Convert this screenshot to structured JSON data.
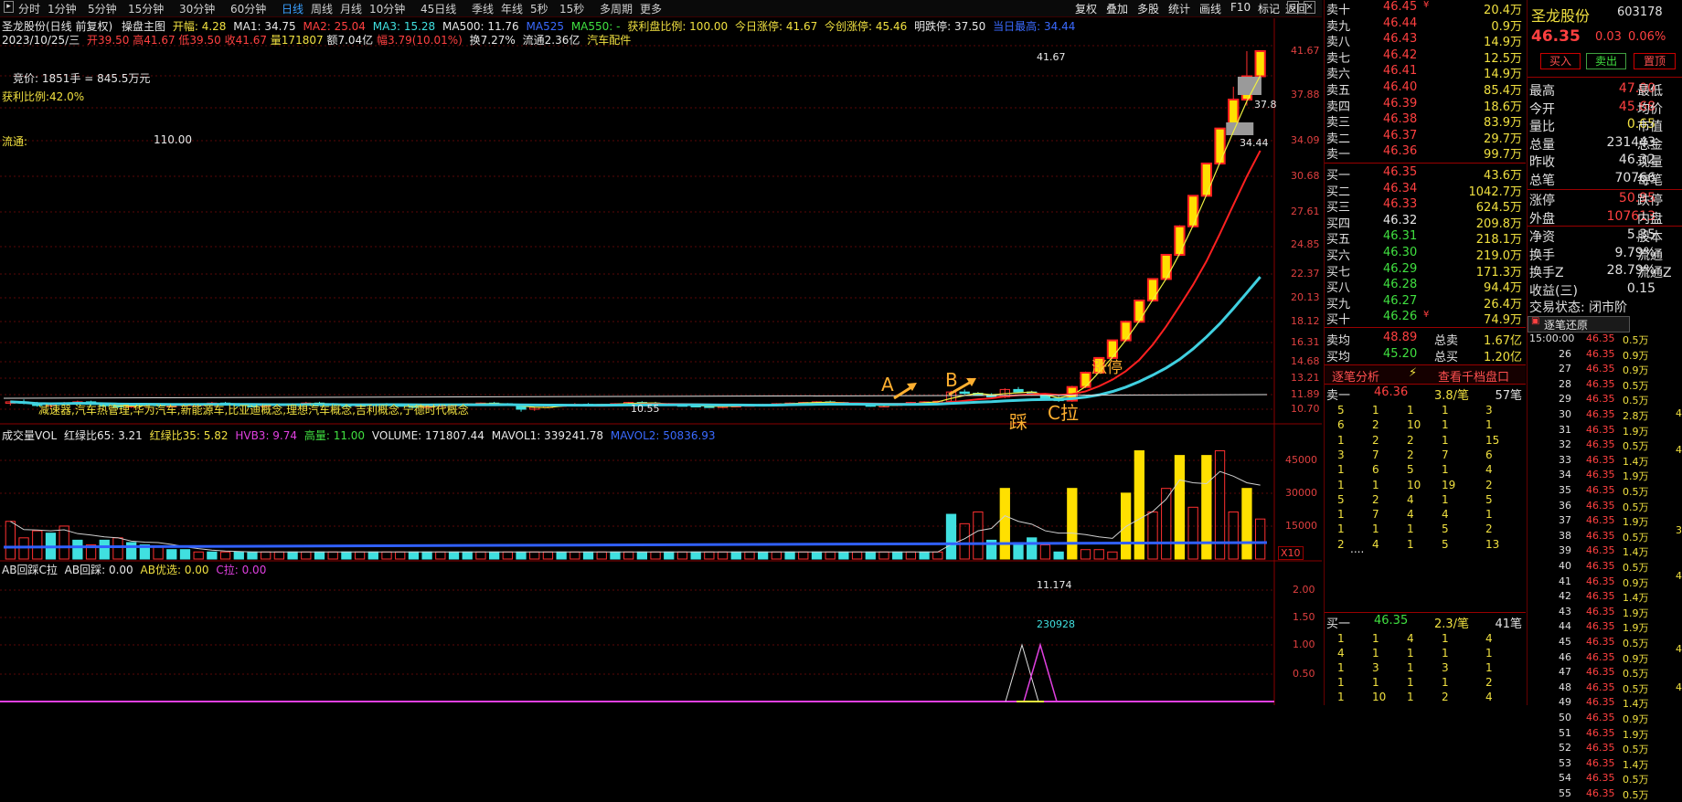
{
  "toolbar": {
    "periods": [
      "分时",
      "1分钟",
      "5分钟",
      "15分钟",
      "30分钟",
      "60分钟",
      "日线",
      "周线",
      "月线",
      "10分钟",
      "45日线",
      "季线",
      "年线",
      "5秒",
      "15秒",
      "多周期",
      "更多"
    ],
    "active_index": 6,
    "right": [
      "复权",
      "叠加",
      "多股",
      "统计",
      "画线",
      "F10",
      "标记",
      "返回"
    ]
  },
  "header": {
    "stock": "圣龙股份(日线 前复权)",
    "indicator": "操盘主图",
    "open_range_label": "开幅: 4.28",
    "ma1": "MA1: 34.75",
    "ma2": "MA2: 25.04",
    "ma3": "MA3: 15.28",
    "ma500": "MA500: 11.76",
    "ma525": "MA525",
    "ma550": "MA550: -",
    "profit_ratio": "获利盘比例: 100.00",
    "limit_up": "今日涨停: 41.67",
    "new_high": "今创涨停: 45.46",
    "limit_down": "明跌停: 37.50",
    "hist_high": "当日最高: 34.44"
  },
  "header2": {
    "date": "2023/10/25/三",
    "open": "开39.50",
    "high": "高41.67",
    "low": "低39.50",
    "close": "收41.67",
    "vol": "量171807",
    "amount": "额7.04亿",
    "change": "幅3.79(10.01%)",
    "turnover": "换7.27%",
    "float": "流通2.36亿",
    "sector": "汽车配件"
  },
  "main_overlay": {
    "bid_price": "竞价: 1851手 = 845.5万元",
    "profit_pct": "获利比例:42.0%",
    "liutong_label": "流通:",
    "liutong_value": "110.00",
    "concepts": "减速器,汽车热管理,华为汽车,新能源车,比亚迪概念,理想汽车概念,吉利概念,宁德时代概念",
    "label_a": "A",
    "label_b": "B",
    "label_c": "C拉",
    "label_cai": "踩",
    "label_zhang": "涨停",
    "low_price": "10.55",
    "top_price": "41.67",
    "mid_price": "37.8",
    "price_34": "34.44"
  },
  "main_axis": [
    "41.67",
    "37.88",
    "34.09",
    "30.68",
    "27.61",
    "24.85",
    "22.37",
    "20.13",
    "18.12",
    "16.31",
    "14.68",
    "13.21",
    "11.89",
    "10.70"
  ],
  "vol_header": {
    "name": "成交量VOL",
    "hl65": "红绿比65: 3.21",
    "hl35": "红绿比35: 5.82",
    "hvb3": "HVB3: 9.74",
    "high": "高量: 11.00",
    "volume": "VOLUME: 171807.44",
    "mavol1": "MAVOL1: 339241.78",
    "mavol2": "MAVOL2: 50836.93"
  },
  "vol_axis": [
    "45000",
    "30000",
    "15000"
  ],
  "vol_unit": "X10",
  "ab_header": {
    "name": "AB回踩C拉",
    "ab_back": "AB回踩: 0.00",
    "ab_pick": "AB优选: 0.00",
    "c_pull": "C拉: 0.00"
  },
  "ab_labels": {
    "peak": "11.174",
    "date": "230928"
  },
  "ab_axis": [
    "2.00",
    "1.50",
    "1.00",
    "0.50"
  ],
  "orderbook": {
    "sells": [
      {
        "label": "卖十",
        "price": "46.45",
        "vol": "20.4万",
        "mark": "¥"
      },
      {
        "label": "卖九",
        "price": "46.44",
        "vol": "0.9万"
      },
      {
        "label": "卖八",
        "price": "46.43",
        "vol": "14.9万"
      },
      {
        "label": "卖七",
        "price": "46.42",
        "vol": "12.5万"
      },
      {
        "label": "卖六",
        "price": "46.41",
        "vol": "14.9万"
      },
      {
        "label": "卖五",
        "price": "46.40",
        "vol": "85.4万"
      },
      {
        "label": "卖四",
        "price": "46.39",
        "vol": "18.6万"
      },
      {
        "label": "卖三",
        "price": "46.38",
        "vol": "83.9万"
      },
      {
        "label": "卖二",
        "price": "46.37",
        "vol": "29.7万"
      },
      {
        "label": "卖一",
        "price": "46.36",
        "vol": "99.7万"
      }
    ],
    "buys": [
      {
        "label": "买一",
        "price": "46.35",
        "vol": "43.6万"
      },
      {
        "label": "买二",
        "price": "46.34",
        "vol": "1042.7万"
      },
      {
        "label": "买三",
        "price": "46.33",
        "vol": "624.5万"
      },
      {
        "label": "买四",
        "price": "46.32",
        "vol": "209.8万"
      },
      {
        "label": "买五",
        "price": "46.31",
        "vol": "218.1万"
      },
      {
        "label": "买六",
        "price": "46.30",
        "vol": "219.0万"
      },
      {
        "label": "买七",
        "price": "46.29",
        "vol": "171.3万"
      },
      {
        "label": "买八",
        "price": "46.28",
        "vol": "94.4万"
      },
      {
        "label": "买九",
        "price": "46.27",
        "vol": "26.4万"
      },
      {
        "label": "买十",
        "price": "46.26",
        "vol": "74.9万",
        "mark": "¥"
      }
    ],
    "avg_sell": {
      "label": "卖均",
      "price": "48.89",
      "tlabel": "总卖",
      "total": "1.67亿"
    },
    "avg_buy": {
      "label": "买均",
      "price": "45.20",
      "tlabel": "总买",
      "total": "1.20亿"
    },
    "tab1": "逐笔分析",
    "tab2": "查看千档盘口",
    "sell_one": {
      "label": "卖一",
      "price": "46.36",
      "per": "3.8/笔",
      "count": "57笔"
    },
    "buy_one": {
      "label": "买一",
      "price": "46.35",
      "per": "2.3/笔",
      "count": "41笔"
    },
    "sell_grid": [
      [
        "5",
        "1",
        "1",
        "1",
        "3"
      ],
      [
        "6",
        "2",
        "10",
        "1",
        "1"
      ],
      [
        "1",
        "2",
        "2",
        "1",
        "15"
      ],
      [
        "3",
        "7",
        "2",
        "7",
        "6"
      ],
      [
        "1",
        "6",
        "5",
        "1",
        "4"
      ],
      [
        "1",
        "1",
        "10",
        "19",
        "2"
      ],
      [
        "5",
        "2",
        "4",
        "1",
        "5"
      ],
      [
        "1",
        "7",
        "4",
        "4",
        "1"
      ],
      [
        "1",
        "1",
        "1",
        "5",
        "2"
      ],
      [
        "2",
        "4",
        "1",
        "5",
        "13"
      ]
    ],
    "ellipsis": "....",
    "buy_grid": [
      [
        "1",
        "1",
        "4",
        "1",
        "4"
      ],
      [
        "4",
        "1",
        "1",
        "1",
        "1"
      ],
      [
        "1",
        "3",
        "1",
        "3",
        "1"
      ],
      [
        "1",
        "1",
        "1",
        "1",
        "2"
      ],
      [
        "1",
        "10",
        "1",
        "2",
        "4"
      ]
    ]
  },
  "info": {
    "name": "圣龙股份",
    "code": "603178",
    "price": "46.35",
    "change": "0.03",
    "pct": "0.06%",
    "buy_btn": "买入",
    "sell_btn": "卖出",
    "trade_btn": "置顶",
    "rows": [
      {
        "k": "最高",
        "v": "47.00",
        "k2": "最低"
      },
      {
        "k": "今开",
        "v": "45.68",
        "k2": "均价"
      },
      {
        "k": "量比",
        "v": "0.65",
        "k2": "市值"
      },
      {
        "k": "总量",
        "v": "231443",
        "k2": "总金"
      },
      {
        "k": "昨收",
        "v": "46.32",
        "k2": "现量"
      },
      {
        "k": "总笔",
        "v": "70766",
        "k2": "每笔"
      }
    ],
    "rows2": [
      {
        "k": "涨停",
        "v": "50.95",
        "k2": "跌停"
      },
      {
        "k": "外盘",
        "v": "107613",
        "k2": "内盘"
      }
    ],
    "rows3": [
      {
        "k": "净资",
        "v": "5.35",
        "k2": "股本"
      },
      {
        "k": "换手",
        "v": "9.79%",
        "k2": "流通"
      },
      {
        "k": "换手Z",
        "v": "28.79%",
        "k2": "流通Z"
      },
      {
        "k": "收益(三)",
        "v": "0.15",
        "k2": ""
      }
    ],
    "status": "交易状态: 闭市阶",
    "ticks_title": "逐笔还原",
    "ticks": [
      {
        "t": "15:00:00",
        "p": "46.35",
        "v": "0.5万"
      },
      {
        "t": "26",
        "p": "46.35",
        "v": "0.9万"
      },
      {
        "t": "27",
        "p": "46.35",
        "v": "0.9万"
      },
      {
        "t": "28",
        "p": "46.35",
        "v": "0.5万"
      },
      {
        "t": "29",
        "p": "46.35",
        "v": "0.5万"
      },
      {
        "t": "30",
        "p": "46.35",
        "v": "2.8万"
      },
      {
        "t": "31",
        "p": "46.35",
        "v": "1.9万"
      },
      {
        "t": "32",
        "p": "46.35",
        "v": "0.5万"
      },
      {
        "t": "33",
        "p": "46.35",
        "v": "1.4万"
      },
      {
        "t": "34",
        "p": "46.35",
        "v": "1.9万"
      },
      {
        "t": "35",
        "p": "46.35",
        "v": "0.5万"
      },
      {
        "t": "36",
        "p": "46.35",
        "v": "0.5万"
      },
      {
        "t": "37",
        "p": "46.35",
        "v": "1.9万"
      },
      {
        "t": "38",
        "p": "46.35",
        "v": "0.5万"
      },
      {
        "t": "39",
        "p": "46.35",
        "v": "1.4万"
      },
      {
        "t": "40",
        "p": "46.35",
        "v": "0.5万"
      },
      {
        "t": "41",
        "p": "46.35",
        "v": "0.9万"
      },
      {
        "t": "42",
        "p": "46.35",
        "v": "1.4万"
      },
      {
        "t": "43",
        "p": "46.35",
        "v": "1.9万"
      },
      {
        "t": "44",
        "p": "46.35",
        "v": "1.9万"
      },
      {
        "t": "45",
        "p": "46.35",
        "v": "0.5万"
      },
      {
        "t": "46",
        "p": "46.35",
        "v": "0.9万"
      },
      {
        "t": "47",
        "p": "46.35",
        "v": "0.5万"
      },
      {
        "t": "48",
        "p": "46.35",
        "v": "0.5万"
      },
      {
        "t": "49",
        "p": "46.35",
        "v": "1.4万"
      },
      {
        "t": "50",
        "p": "46.35",
        "v": "0.9万"
      },
      {
        "t": "51",
        "p": "46.35",
        "v": "1.9万"
      },
      {
        "t": "52",
        "p": "46.35",
        "v": "0.5万"
      },
      {
        "t": "53",
        "p": "46.35",
        "v": "1.4万"
      },
      {
        "t": "54",
        "p": "46.35",
        "v": "0.5万"
      },
      {
        "t": "55",
        "p": "46.35",
        "v": "0.5万"
      }
    ],
    "side_nums": [
      "4",
      "4",
      "3",
      "4",
      "4",
      "4"
    ]
  },
  "candles": [
    [
      11.2,
      11.4,
      11.0,
      11.3
    ],
    [
      11.3,
      11.5,
      11.1,
      11.2
    ],
    [
      11.2,
      11.3,
      10.9,
      11.0
    ],
    [
      11.0,
      11.2,
      10.8,
      11.1
    ],
    [
      11.1,
      11.3,
      11.0,
      11.2
    ],
    [
      11.2,
      11.4,
      11.1,
      11.3
    ],
    [
      11.3,
      11.4,
      11.0,
      11.1
    ],
    [
      11.1,
      11.2,
      10.9,
      11.0
    ],
    [
      11.0,
      11.1,
      10.8,
      10.9
    ],
    [
      10.9,
      11.1,
      10.8,
      11.0
    ],
    [
      11.0,
      11.2,
      10.9,
      11.1
    ],
    [
      11.1,
      11.2,
      10.9,
      11.0
    ],
    [
      11.0,
      11.1,
      10.9,
      11.0
    ],
    [
      11.0,
      11.2,
      10.9,
      11.1
    ],
    [
      11.1,
      11.2,
      11.0,
      11.1
    ],
    [
      11.1,
      11.3,
      11.0,
      11.2
    ],
    [
      11.2,
      11.3,
      11.0,
      11.1
    ],
    [
      11.1,
      11.2,
      10.9,
      11.0
    ],
    [
      11.0,
      11.1,
      10.9,
      10.95
    ],
    [
      10.95,
      11.1,
      10.9,
      11.05
    ],
    [
      11.05,
      11.2,
      11.0,
      11.1
    ],
    [
      11.1,
      11.2,
      11.0,
      11.15
    ],
    [
      11.15,
      11.3,
      11.1,
      11.2
    ],
    [
      11.2,
      11.3,
      11.1,
      11.15
    ],
    [
      11.15,
      11.2,
      11.0,
      11.05
    ],
    [
      11.05,
      11.1,
      10.9,
      11.0
    ],
    [
      11.0,
      11.1,
      10.9,
      11.05
    ],
    [
      11.05,
      11.15,
      11.0,
      11.1
    ],
    [
      11.1,
      11.2,
      11.0,
      11.05
    ],
    [
      11.05,
      11.1,
      10.95,
      11.0
    ],
    [
      11.0,
      11.05,
      10.8,
      10.85
    ],
    [
      10.85,
      11.0,
      10.8,
      10.95
    ],
    [
      10.95,
      11.1,
      10.9,
      11.05
    ],
    [
      11.05,
      11.15,
      11.0,
      11.1
    ],
    [
      11.1,
      11.2,
      11.05,
      11.15
    ],
    [
      11.15,
      11.25,
      11.1,
      11.2
    ],
    [
      11.2,
      11.3,
      11.1,
      11.15
    ],
    [
      11.15,
      11.2,
      11.0,
      11.05
    ],
    [
      11.05,
      11.1,
      10.55,
      10.7
    ],
    [
      10.7,
      10.9,
      10.6,
      10.85
    ],
    [
      10.85,
      11.0,
      10.8,
      10.95
    ],
    [
      10.95,
      11.1,
      10.9,
      11.05
    ],
    [
      11.05,
      11.2,
      11.0,
      11.1
    ],
    [
      11.1,
      11.2,
      11.0,
      11.05
    ],
    [
      11.05,
      11.15,
      11.0,
      11.1
    ],
    [
      11.1,
      11.2,
      11.05,
      11.15
    ],
    [
      11.15,
      11.3,
      11.1,
      11.25
    ],
    [
      11.25,
      11.35,
      11.15,
      11.2
    ],
    [
      11.2,
      11.3,
      11.1,
      11.15
    ],
    [
      11.15,
      11.2,
      11.0,
      11.05
    ],
    [
      11.05,
      11.15,
      10.95,
      11.0
    ],
    [
      11.0,
      11.1,
      10.9,
      10.95
    ],
    [
      10.95,
      11.05,
      10.85,
      10.9
    ],
    [
      10.9,
      11.0,
      10.8,
      10.95
    ],
    [
      10.95,
      11.05,
      10.9,
      11.0
    ],
    [
      11.0,
      11.1,
      10.95,
      11.05
    ],
    [
      11.05,
      11.15,
      11.0,
      11.1
    ],
    [
      11.1,
      11.2,
      11.05,
      11.15
    ],
    [
      11.15,
      11.25,
      11.1,
      11.2
    ],
    [
      11.2,
      11.3,
      11.15,
      11.25
    ],
    [
      11.25,
      11.35,
      11.2,
      11.3
    ],
    [
      11.3,
      11.4,
      11.2,
      11.25
    ],
    [
      11.25,
      11.3,
      11.1,
      11.15
    ],
    [
      11.15,
      11.2,
      11.0,
      11.05
    ],
    [
      11.05,
      11.1,
      10.9,
      10.95
    ],
    [
      10.95,
      11.05,
      10.85,
      11.0
    ],
    [
      11.0,
      11.2,
      10.95,
      11.15
    ],
    [
      11.15,
      11.3,
      11.1,
      11.25
    ],
    [
      11.25,
      11.35,
      11.2,
      11.3
    ],
    [
      11.3,
      11.4,
      11.25,
      11.35
    ],
    [
      11.35,
      12.2,
      11.3,
      12.1
    ],
    [
      12.1,
      12.3,
      11.9,
      12.0
    ],
    [
      12.0,
      12.1,
      11.8,
      11.9
    ],
    [
      11.9,
      12.0,
      11.6,
      11.7
    ],
    [
      11.7,
      12.4,
      11.6,
      12.3
    ],
    [
      12.3,
      12.5,
      12.0,
      12.1
    ],
    [
      12.1,
      12.2,
      11.8,
      11.9
    ],
    [
      11.9,
      12.0,
      11.5,
      11.6
    ],
    [
      11.6,
      11.8,
      11.3,
      11.4
    ],
    [
      11.4,
      12.6,
      11.3,
      12.5
    ],
    [
      12.5,
      13.8,
      12.4,
      13.7
    ],
    [
      13.7,
      15.0,
      13.6,
      15.0
    ],
    [
      15.0,
      16.5,
      14.9,
      16.5
    ],
    [
      16.5,
      18.2,
      16.4,
      18.1
    ],
    [
      18.1,
      19.9,
      18.0,
      19.9
    ],
    [
      19.9,
      21.9,
      19.8,
      21.9
    ],
    [
      21.9,
      24.0,
      21.8,
      24.0
    ],
    [
      24.0,
      26.5,
      23.9,
      26.4
    ],
    [
      26.4,
      29.0,
      26.3,
      29.0
    ],
    [
      29.0,
      31.9,
      28.9,
      31.9
    ],
    [
      31.9,
      35.1,
      31.8,
      35.1
    ],
    [
      35.1,
      38.6,
      34.9,
      37.5
    ],
    [
      37.5,
      41.67,
      37.0,
      39.5
    ],
    [
      39.5,
      41.67,
      39.5,
      41.67
    ]
  ],
  "volumes": [
    [
      16,
      1
    ],
    [
      9,
      1
    ],
    [
      12,
      1
    ],
    [
      11,
      0
    ],
    [
      14,
      1
    ],
    [
      8,
      0
    ],
    [
      6,
      1
    ],
    [
      8,
      0
    ],
    [
      9,
      1
    ],
    [
      7,
      0
    ],
    [
      6,
      0
    ],
    [
      5,
      1
    ],
    [
      4,
      0
    ],
    [
      4,
      0
    ],
    [
      3,
      1
    ],
    [
      3,
      0
    ],
    [
      3,
      1
    ],
    [
      3,
      0
    ],
    [
      3,
      0
    ],
    [
      3,
      1
    ],
    [
      3,
      1
    ],
    [
      3,
      0
    ],
    [
      3,
      1
    ],
    [
      3,
      0
    ],
    [
      3,
      1
    ],
    [
      3,
      0
    ],
    [
      3,
      1
    ],
    [
      3,
      0
    ],
    [
      3,
      1
    ],
    [
      3,
      1
    ],
    [
      3,
      0
    ],
    [
      3,
      0
    ],
    [
      3,
      1
    ],
    [
      3,
      0
    ],
    [
      3,
      0
    ],
    [
      3,
      1
    ],
    [
      3,
      0
    ],
    [
      3,
      1
    ],
    [
      3,
      0
    ],
    [
      3,
      1
    ],
    [
      3,
      1
    ],
    [
      3,
      0
    ],
    [
      3,
      1
    ],
    [
      3,
      0
    ],
    [
      3,
      1
    ],
    [
      3,
      0
    ],
    [
      3,
      1
    ],
    [
      3,
      0
    ],
    [
      3,
      1
    ],
    [
      3,
      0
    ],
    [
      3,
      1
    ],
    [
      3,
      0
    ],
    [
      3,
      1
    ],
    [
      3,
      1
    ],
    [
      3,
      0
    ],
    [
      3,
      1
    ],
    [
      3,
      0
    ],
    [
      3,
      1
    ],
    [
      3,
      0
    ],
    [
      3,
      1
    ],
    [
      3,
      0
    ],
    [
      3,
      1
    ],
    [
      3,
      0
    ],
    [
      3,
      1
    ],
    [
      3,
      0
    ],
    [
      3,
      1
    ],
    [
      3,
      0
    ],
    [
      3,
      1
    ],
    [
      3,
      0
    ],
    [
      3,
      1
    ],
    [
      19,
      0
    ],
    [
      15,
      1
    ],
    [
      20,
      1
    ],
    [
      8,
      0
    ],
    [
      30,
      2
    ],
    [
      7,
      0
    ],
    [
      9,
      0
    ],
    [
      6,
      1
    ],
    [
      3,
      0
    ],
    [
      30,
      2
    ],
    [
      4,
      1
    ],
    [
      4,
      1
    ],
    [
      3,
      1
    ],
    [
      28,
      2
    ],
    [
      46,
      2
    ],
    [
      20,
      1
    ],
    [
      30,
      1
    ],
    [
      44,
      2
    ],
    [
      22,
      1
    ],
    [
      44,
      2
    ],
    [
      46,
      1
    ],
    [
      20,
      1
    ],
    [
      30,
      2
    ],
    [
      17,
      1
    ]
  ]
}
